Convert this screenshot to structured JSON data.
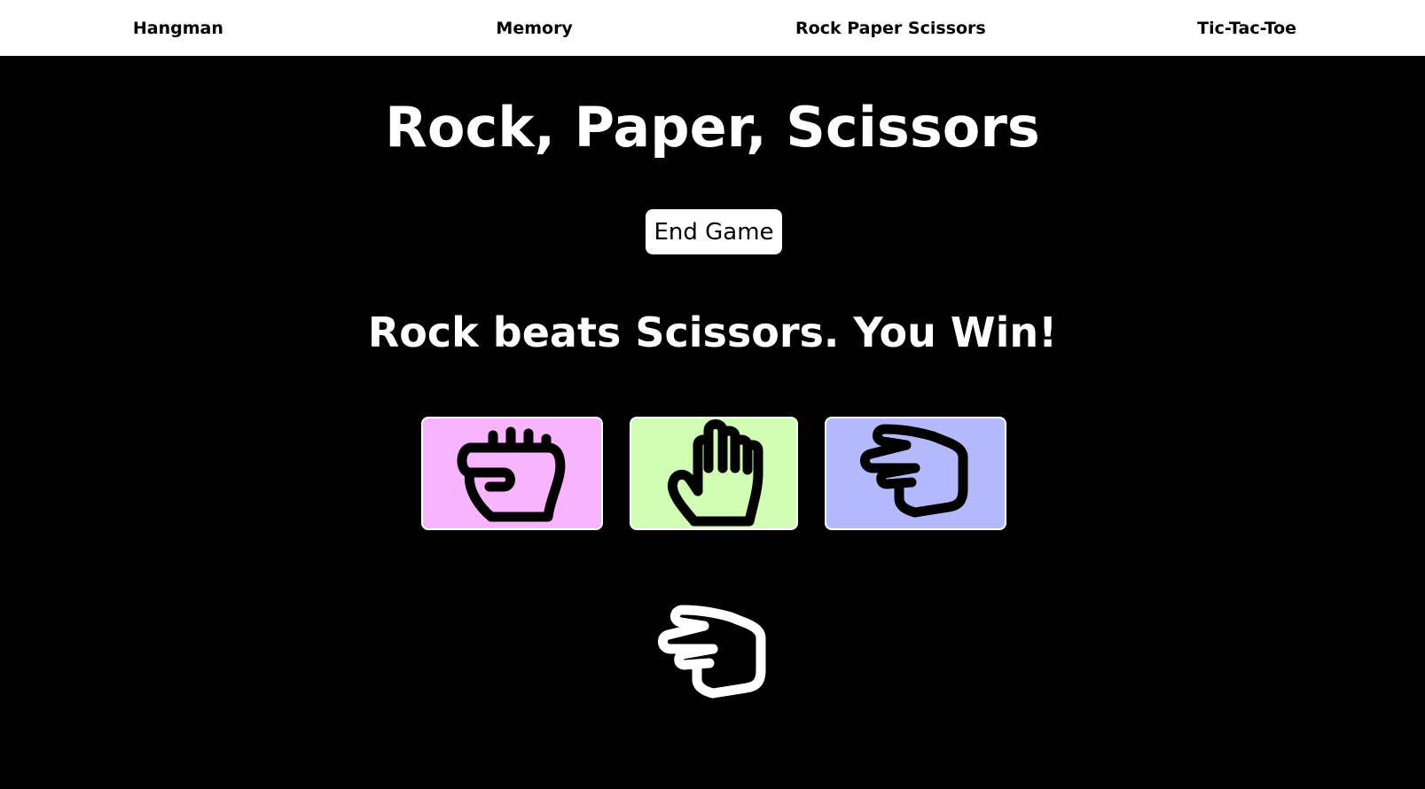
{
  "nav": {
    "items": [
      {
        "label": "Hangman"
      },
      {
        "label": "Memory"
      },
      {
        "label": "Rock Paper Scissors"
      },
      {
        "label": "Tic-Tac-Toe"
      }
    ]
  },
  "game": {
    "title": "Rock, Paper, Scissors",
    "end_button_label": "End Game",
    "result_text": "Rock beats Scissors. You Win!",
    "choices": [
      {
        "name": "rock",
        "icon": "rock-hand-icon",
        "color": "#f8b4fe"
      },
      {
        "name": "paper",
        "icon": "paper-hand-icon",
        "color": "#d2fdb4"
      },
      {
        "name": "scissors",
        "icon": "scissors-hand-icon",
        "color": "#b4b9fe"
      }
    ],
    "computer_choice": {
      "name": "scissors",
      "icon": "scissors-hand-icon",
      "color": "#ffffff"
    }
  }
}
